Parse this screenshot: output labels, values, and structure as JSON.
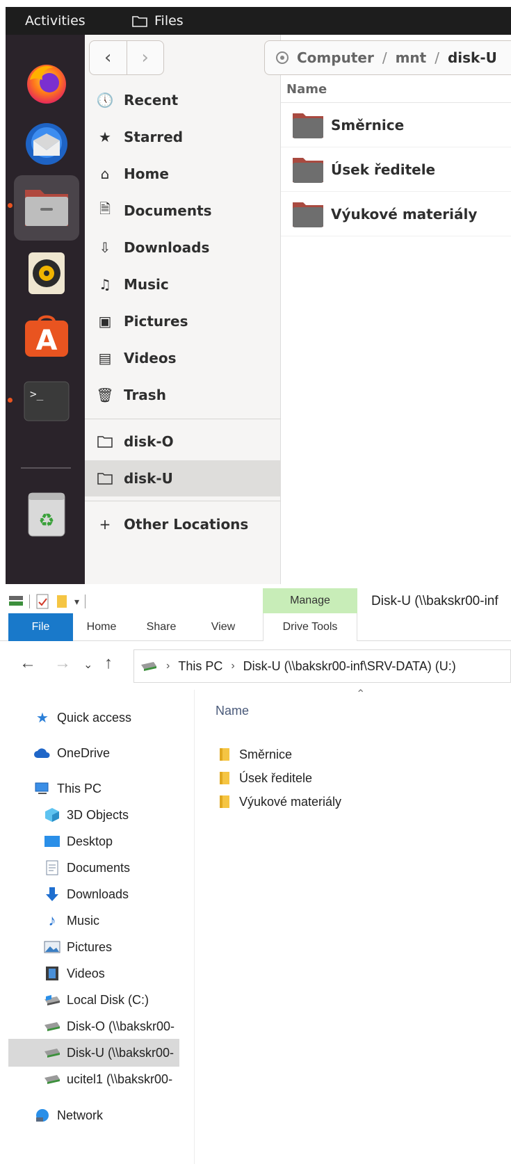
{
  "ubuntu": {
    "topbar": {
      "activities": "Activities",
      "app_name": "Files"
    },
    "dock": [
      {
        "name": "firefox-icon",
        "running": false
      },
      {
        "name": "thunderbird-icon",
        "running": false
      },
      {
        "name": "files-icon",
        "running": true,
        "active": true
      },
      {
        "name": "rhythmbox-icon",
        "running": false
      },
      {
        "name": "software-center-icon",
        "running": false
      },
      {
        "name": "terminal-icon",
        "running": true
      },
      {
        "name": "trash-icon",
        "running": false
      }
    ],
    "nav": {
      "back": "‹",
      "forward": "›"
    },
    "path": {
      "root": "Computer",
      "sep": "/",
      "mid": "mnt",
      "current": "disk-U"
    },
    "sidebar": {
      "places": [
        {
          "label": "Recent",
          "icon": "clock-icon",
          "glyph": "🕔"
        },
        {
          "label": "Starred",
          "icon": "star-icon",
          "glyph": "★"
        },
        {
          "label": "Home",
          "icon": "home-icon",
          "glyph": "⌂"
        },
        {
          "label": "Documents",
          "icon": "document-icon",
          "glyph": "🗎"
        },
        {
          "label": "Downloads",
          "icon": "download-icon",
          "glyph": "⇩"
        },
        {
          "label": "Music",
          "icon": "music-icon",
          "glyph": "♫"
        },
        {
          "label": "Pictures",
          "icon": "picture-icon",
          "glyph": "▣"
        },
        {
          "label": "Videos",
          "icon": "video-icon",
          "glyph": "▤"
        },
        {
          "label": "Trash",
          "icon": "trash-icon",
          "glyph": "🗑"
        }
      ],
      "mounts": [
        {
          "label": "disk-O",
          "icon": "folder-icon"
        },
        {
          "label": "disk-U",
          "icon": "folder-icon",
          "selected": true
        }
      ],
      "other": {
        "label": "Other Locations",
        "glyph": "+"
      }
    },
    "list": {
      "column_name": "Name",
      "rows": [
        "Směrnice",
        "Úsek ředitele",
        "Výukové materiály"
      ]
    }
  },
  "windows": {
    "manage": "Manage",
    "title": "Disk-U (\\\\bakskr00-inf",
    "ribbon_tabs": [
      "File",
      "Home",
      "Share",
      "View"
    ],
    "drive_tools": "Drive Tools",
    "address": {
      "root": "This PC",
      "current": "Disk-U (\\\\bakskr00-inf\\SRV-DATA) (U:)"
    },
    "nav": [
      {
        "label": "Quick access",
        "icon": "quick-access-star-icon",
        "level": 0
      },
      {
        "label": "OneDrive",
        "icon": "onedrive-cloud-icon",
        "level": 0
      },
      {
        "label": "This PC",
        "icon": "this-pc-icon",
        "level": 0
      },
      {
        "label": "3D Objects",
        "icon": "3d-objects-icon",
        "level": 1
      },
      {
        "label": "Desktop",
        "icon": "desktop-icon",
        "level": 1
      },
      {
        "label": "Documents",
        "icon": "documents-icon",
        "level": 1
      },
      {
        "label": "Downloads",
        "icon": "downloads-arrow-icon",
        "level": 1
      },
      {
        "label": "Music",
        "icon": "music-note-icon",
        "level": 1
      },
      {
        "label": "Pictures",
        "icon": "pictures-icon",
        "level": 1
      },
      {
        "label": "Videos",
        "icon": "videos-icon",
        "level": 1
      },
      {
        "label": "Local Disk (C:)",
        "icon": "local-disk-icon",
        "level": 1
      },
      {
        "label": "Disk-O (\\\\bakskr00-",
        "icon": "network-drive-icon",
        "level": 1
      },
      {
        "label": "Disk-U (\\\\bakskr00-",
        "icon": "network-drive-icon",
        "level": 1,
        "selected": true
      },
      {
        "label": "ucitel1 (\\\\bakskr00-",
        "icon": "network-drive-icon",
        "level": 1
      },
      {
        "label": "Network",
        "icon": "network-icon",
        "level": 0
      }
    ],
    "list": {
      "column_name": "Name",
      "rows": [
        "Směrnice",
        "Úsek ředitele",
        "Výukové materiály"
      ]
    }
  }
}
